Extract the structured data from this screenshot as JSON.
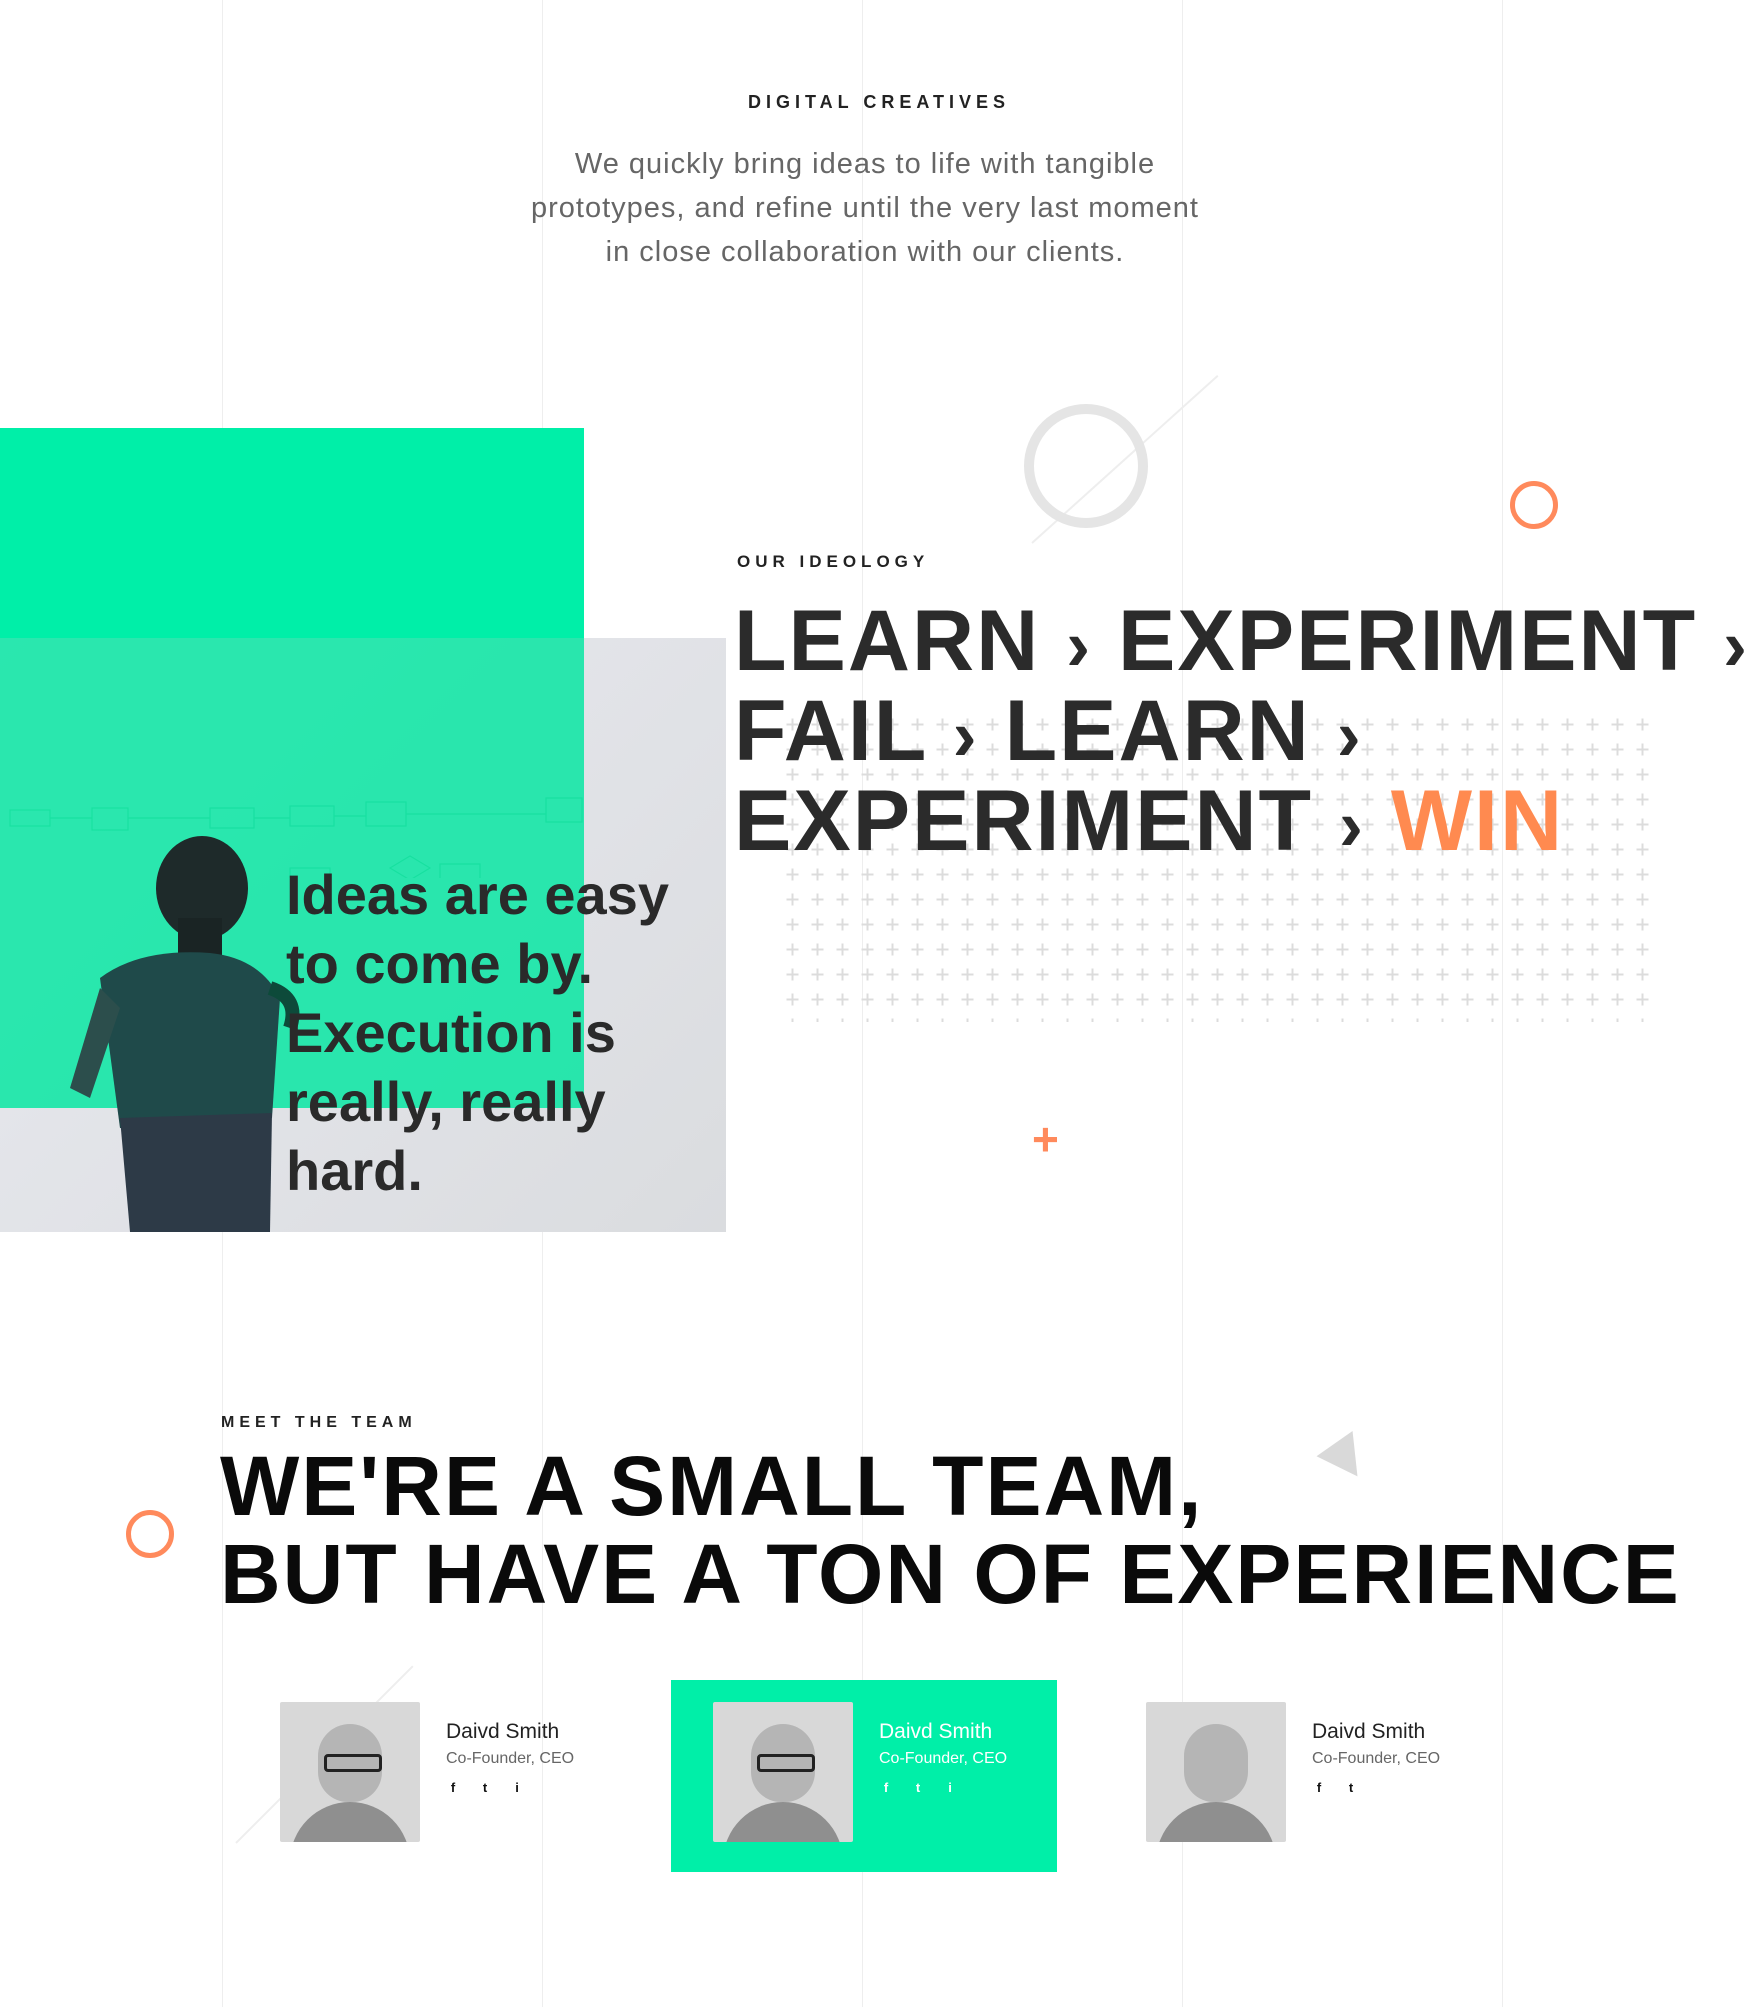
{
  "header": {
    "kicker": "DIGITAL CREATIVES",
    "intro": "We quickly bring ideas to life with tangible prototypes, and refine until the very last moment in close collaboration with our clients."
  },
  "ideology": {
    "kicker": "OUR IDEOLOGY",
    "words": [
      "LEARN",
      "EXPERIMENT",
      "FAIL",
      "LEARN",
      "EXPERIMENT",
      "WIN"
    ],
    "quote": "Ideas are easy to come by. Execution is really, really hard."
  },
  "team": {
    "kicker": "MEET THE TEAM",
    "heading_line1": "WE'RE A SMALL TEAM,",
    "heading_line2": "BUT HAVE A TON OF EXPERIENCE",
    "members": [
      {
        "name": "Daivd Smith",
        "role": "Co-Founder, CEO",
        "socials": [
          "f",
          "t",
          "i"
        ]
      },
      {
        "name": "Daivd Smith",
        "role": "Co-Founder, CEO",
        "socials": [
          "f",
          "t",
          "i"
        ]
      },
      {
        "name": "Daivd Smith",
        "role": "Co-Founder, CEO",
        "socials": [
          "f",
          "t"
        ]
      }
    ]
  },
  "colors": {
    "accent_green": "#00efa8",
    "accent_orange": "#ff8a50",
    "text_dark": "#222222",
    "text_muted": "#666666"
  },
  "icons": {
    "facebook": "facebook-icon",
    "twitter": "twitter-icon",
    "instagram": "instagram-icon"
  }
}
